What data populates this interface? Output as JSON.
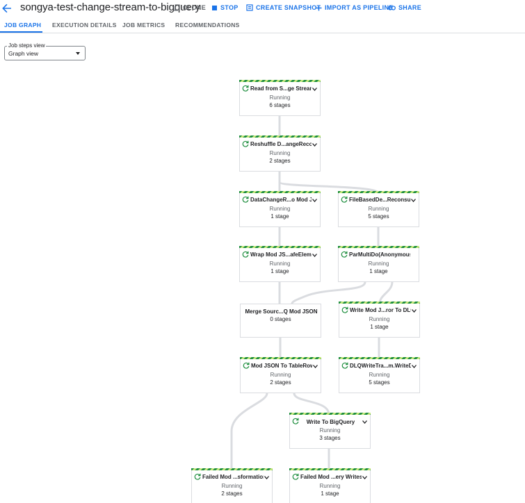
{
  "header": {
    "job_title": "songya-test-change-stream-to-bigquery",
    "actions": {
      "clone": "CLONE",
      "stop": "STOP",
      "create_snapshot": "CREATE SNAPSHOT",
      "import_as_pipeline": "IMPORT AS PIPELINE",
      "share": "SHARE"
    }
  },
  "tabs": {
    "job_graph": "JOB GRAPH",
    "execution_details": "EXECUTION DETAILS",
    "job_metrics": "JOB METRICS",
    "recommendations": "RECOMMENDATIONS"
  },
  "steps_view": {
    "label": "Job steps view",
    "value": "Graph view"
  },
  "nodes": {
    "read": {
      "name": "Read from S...ge Streams",
      "status": "Running",
      "stages": "6 stages"
    },
    "reshuffle": {
      "name": "Reshuffle D...angeRecord",
      "status": "Running",
      "stages": "2 stages"
    },
    "datachange": {
      "name": "DataChangeR...o Mod JSON",
      "status": "Running",
      "stages": "1 stage"
    },
    "filebased": {
      "name": "FileBasedDe...Reconsumer",
      "status": "Running",
      "stages": "5 stages"
    },
    "wrap": {
      "name": "Wrap Mod JS...afeElement",
      "status": "Running",
      "stages": "1 stage"
    },
    "parmulti": {
      "name": "ParMultiDo(Anonymous)",
      "status": "Running",
      "stages": "1 stage"
    },
    "merge": {
      "name": "Merge Sourc...Q Mod JSON",
      "status": "",
      "stages": "0 stages"
    },
    "writemod": {
      "name": "Write Mod J...ror To DLQ",
      "status": "Running",
      "stages": "1 stage"
    },
    "modjson": {
      "name": "Mod JSON To TableRow",
      "status": "Running",
      "stages": "2 stages"
    },
    "dlqwrite": {
      "name": "DLQWriteTra...m.WriteDLQ",
      "status": "Running",
      "stages": "5 stages"
    },
    "writebq": {
      "name": "Write To BigQuery",
      "status": "Running",
      "stages": "3 stages"
    },
    "failedmod": {
      "name": "Failed Mod ...sformation",
      "status": "Running",
      "stages": "2 stages"
    },
    "failedwrites": {
      "name": "Failed Mod ...ery Writes",
      "status": "Running",
      "stages": "1 stage"
    }
  },
  "colors": {
    "accent": "#1a73e8",
    "running_green": "#1e8e3e",
    "edge": "#dadce0"
  }
}
